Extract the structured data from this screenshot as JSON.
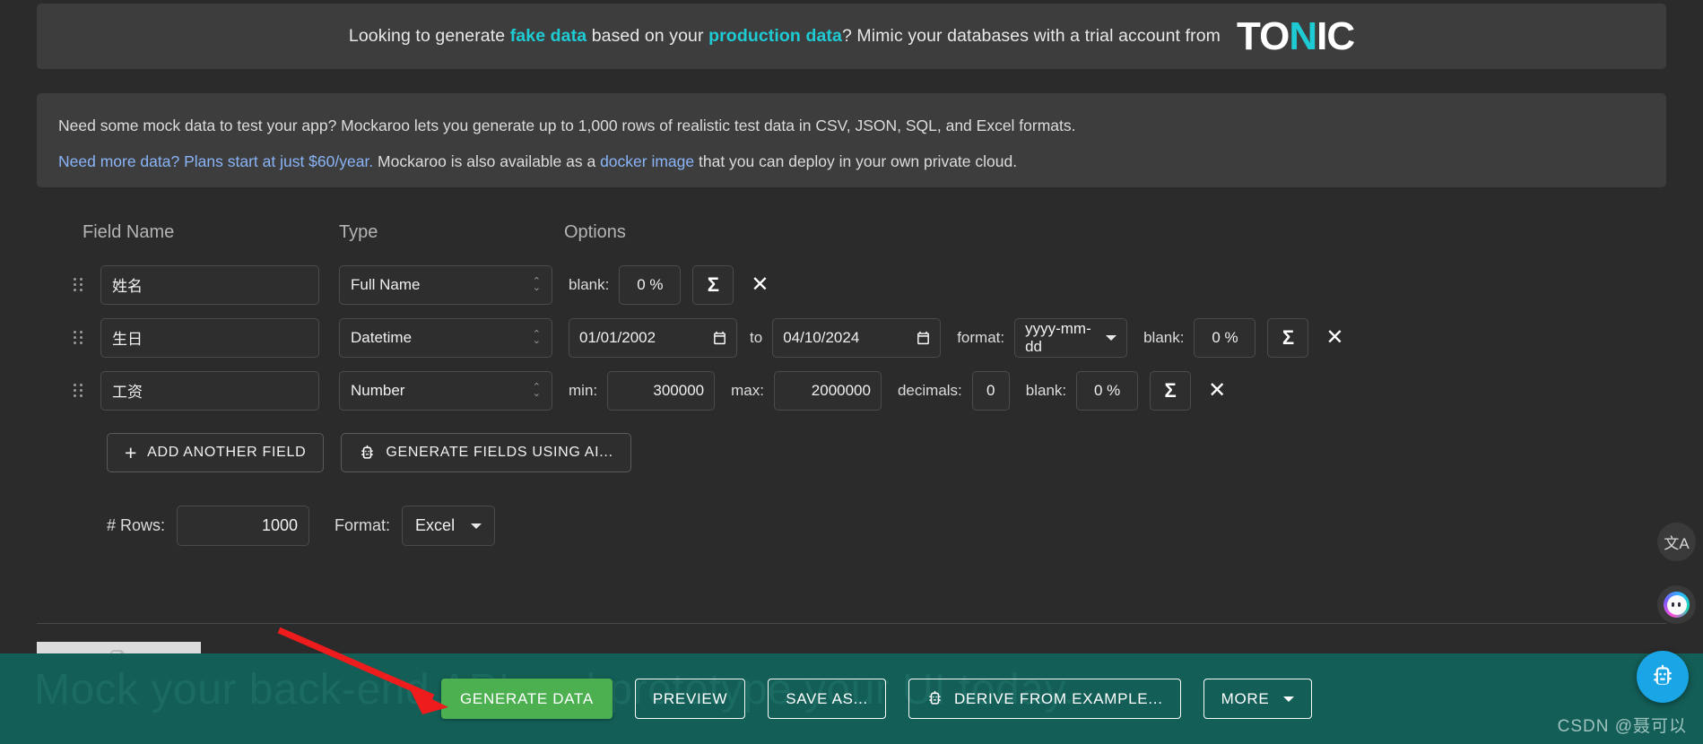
{
  "promo": {
    "text_before": "Looking to generate ",
    "hl1": "fake data",
    "text_mid": " based on your ",
    "hl2": "production data",
    "text_after": "? Mimic your databases with a trial account from",
    "logo_part1": "TO",
    "logo_part2": "N",
    "logo_part3": "IC"
  },
  "info": {
    "line1": "Need some mock data to test your app? Mockaroo lets you generate up to 1,000 rows of realistic test data in CSV, JSON, SQL, and Excel formats.",
    "line2_link": "Need more data? Plans start at just $60/year.",
    "line2_mid": " Mockaroo is also available as a ",
    "line2_link2": "docker image",
    "line2_end": " that you can deploy in your own private cloud."
  },
  "columns": {
    "field_name": "Field Name",
    "type": "Type",
    "options": "Options"
  },
  "fields": [
    {
      "name": "姓名",
      "type": "Full Name",
      "blank_label": "blank:",
      "blank_value": "0 %",
      "sigma": "Σ",
      "remove": "✕"
    },
    {
      "name": "生日",
      "type": "Datetime",
      "date_from": "01/01/2002",
      "to_label": "to",
      "date_to": "04/10/2024",
      "format_label": "format:",
      "format_value": "yyyy-mm-dd",
      "blank_label": "blank:",
      "blank_value": "0 %",
      "sigma": "Σ",
      "remove": "✕"
    },
    {
      "name": "工资",
      "type": "Number",
      "min_label": "min:",
      "min_value": "300000",
      "max_label": "max:",
      "max_value": "2000000",
      "decimals_label": "decimals:",
      "decimals_value": "0",
      "blank_label": "blank:",
      "blank_value": "0 %",
      "sigma": "Σ",
      "remove": "✕"
    }
  ],
  "actions": {
    "add_field": "ADD ANOTHER FIELD",
    "add_field_icon": "+",
    "generate_ai": "GENERATE FIELDS USING AI..."
  },
  "settings": {
    "rows_label": "# Rows:",
    "rows_value": "1000",
    "format_label": "Format:",
    "format_value": "Excel"
  },
  "footer": {
    "ghost_text": "Mock your back-end API and prototype your UI today.",
    "generate_data": "GENERATE DATA",
    "preview": "PREVIEW",
    "save_as": "SAVE AS...",
    "derive": "DERIVE FROM EXAMPLE...",
    "more": "MORE",
    "watermark": "CSDN @聂可以"
  },
  "widgets": {
    "translate_icon": "文A"
  },
  "colors": {
    "page_bg": "#2b2b2b",
    "panel_bg": "#3d3d3d",
    "accent_teal": "#1ecbd4",
    "link_blue": "#8ab4f8",
    "footer_teal": "#135e57",
    "generate_green": "#4caf50",
    "annotation_red": "#ee1c1c"
  }
}
